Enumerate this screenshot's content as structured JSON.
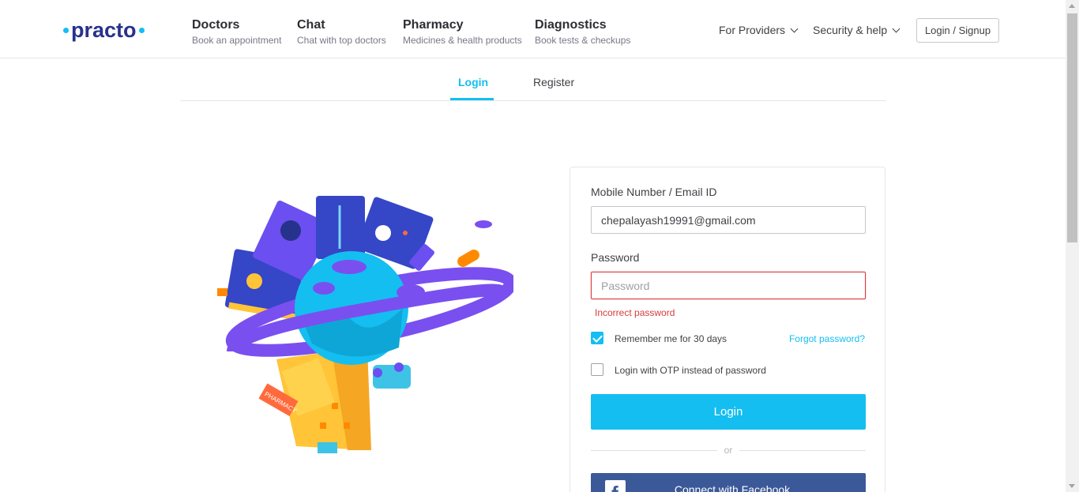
{
  "brand": {
    "name": "practo",
    "accent": "#14bef0",
    "navy": "#28328c"
  },
  "nav": [
    {
      "title": "Doctors",
      "subtitle": "Book an appointment"
    },
    {
      "title": "Chat",
      "subtitle": "Chat with top doctors"
    },
    {
      "title": "Pharmacy",
      "subtitle": "Medicines & health products"
    },
    {
      "title": "Diagnostics",
      "subtitle": "Book tests & checkups"
    }
  ],
  "header_right": {
    "providers": "For Providers",
    "security": "Security & help",
    "login_signup": "Login / Signup"
  },
  "tabs": {
    "login": "Login",
    "register": "Register"
  },
  "illustration": {
    "pharmacy_sign": "PHARMACY"
  },
  "form": {
    "email_label": "Mobile Number / Email ID",
    "email_value": "chepalayash19991@gmail.com",
    "password_label": "Password",
    "password_placeholder": "Password",
    "error": "Incorrect password",
    "remember_label": "Remember me for 30 days",
    "remember_checked": true,
    "forgot": "Forgot password?",
    "otp_label": "Login with OTP instead of password",
    "otp_checked": false,
    "submit": "Login",
    "or": "or",
    "facebook": "Connect with Facebook",
    "facebook_icon": "f"
  }
}
